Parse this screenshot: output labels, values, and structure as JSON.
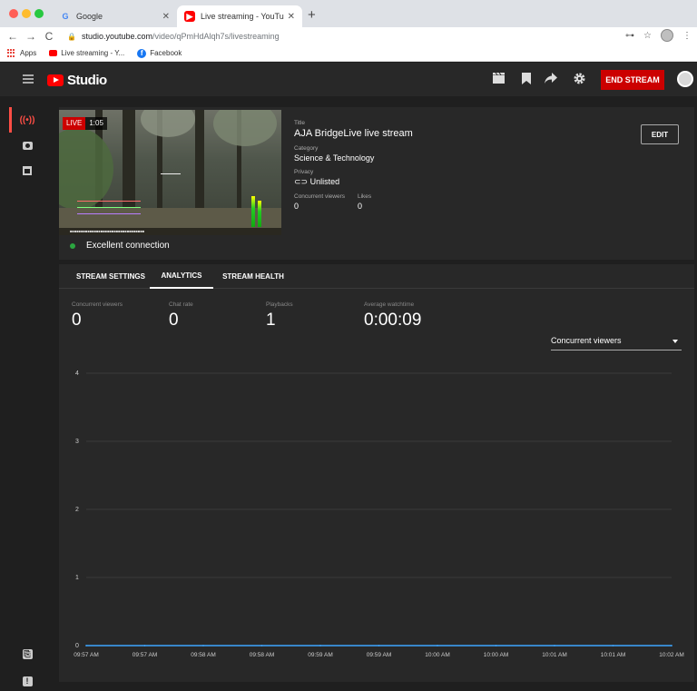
{
  "browser": {
    "tabs": [
      {
        "title": "Google",
        "favicon": "google-icon",
        "active": false
      },
      {
        "title": "Live streaming - YouTube Studio",
        "favicon": "youtube-icon",
        "active": true
      }
    ],
    "url_host": "studio.youtube.com",
    "url_path": "/video/qPmHdAlqh7s/livestreaming",
    "bookmarks": [
      {
        "label": "Apps",
        "icon": "apps-grid-icon"
      },
      {
        "label": "Live streaming - Y...",
        "icon": "youtube-icon"
      },
      {
        "label": "Facebook",
        "icon": "facebook-icon"
      }
    ]
  },
  "header": {
    "logo_text": "Studio",
    "end_stream_label": "END STREAM",
    "icons": [
      "clapperboard-icon",
      "bookmark-icon",
      "share-icon",
      "gear-icon"
    ],
    "accent_color": "#cc0000"
  },
  "rail": {
    "items": [
      "live-icon",
      "camera-icon",
      "calendar-icon"
    ],
    "bottom_items": [
      "copy-icon",
      "feedback-icon"
    ]
  },
  "stream": {
    "live_label": "LIVE",
    "elapsed": "1:05",
    "connection_status": "Excellent connection",
    "connection_color": "#2ba640",
    "title_label": "Title",
    "title": "AJA BridgeLive live stream",
    "category_label": "Category",
    "category": "Science & Technology",
    "privacy_label": "Privacy",
    "privacy": "Unlisted",
    "concurrent_label": "Concurrent viewers",
    "concurrent": "0",
    "likes_label": "Likes",
    "likes": "0",
    "edit_label": "EDIT"
  },
  "analytics": {
    "tabs": [
      {
        "label": "STREAM SETTINGS",
        "active": false
      },
      {
        "label": "ANALYTICS",
        "active": true
      },
      {
        "label": "STREAM HEALTH",
        "active": false
      }
    ],
    "stats": [
      {
        "label": "Concurrent viewers",
        "value": "0"
      },
      {
        "label": "Chat rate",
        "value": "0"
      },
      {
        "label": "Playbacks",
        "value": "1"
      },
      {
        "label": "Average watchtime",
        "value": "0:00:09"
      }
    ],
    "metric_select": "Concurrent viewers"
  },
  "chart_data": {
    "type": "line",
    "categories": [
      "09:57 AM",
      "09:57 AM",
      "09:58 AM",
      "09:58 AM",
      "09:59 AM",
      "09:59 AM",
      "10:00 AM",
      "10:00 AM",
      "10:01 AM",
      "10:01 AM",
      "10:02 AM"
    ],
    "yticks": [
      0,
      1,
      2,
      3,
      4
    ],
    "ylim": [
      0,
      4
    ],
    "grid": true,
    "series": [
      {
        "values": [
          0,
          0,
          0,
          0,
          0,
          0,
          0,
          0,
          0,
          0,
          0
        ],
        "color": "#3ea6ff"
      }
    ]
  }
}
